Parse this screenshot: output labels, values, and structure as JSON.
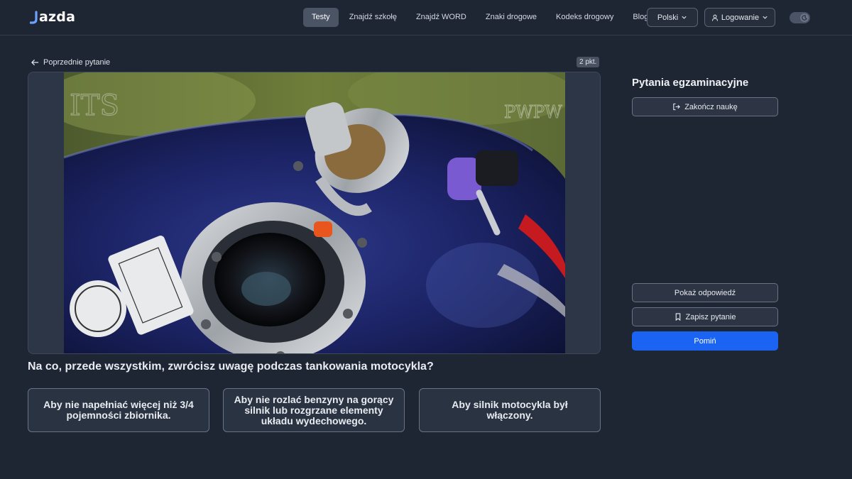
{
  "header": {
    "logo_text": "azda",
    "nav": [
      {
        "label": "Testy",
        "active": true
      },
      {
        "label": "Znajdź szkołę",
        "active": false
      },
      {
        "label": "Znajdź WORD",
        "active": false
      },
      {
        "label": "Znaki drogowe",
        "active": false
      },
      {
        "label": "Kodeks drogowy",
        "active": false
      },
      {
        "label": "Blog",
        "active": false
      }
    ],
    "language_label": "Polski",
    "login_label": "Logowanie",
    "theme_toggle_icon": "moon-icon"
  },
  "question": {
    "prev_label": "Poprzednie pytanie",
    "points": "2 pkt.",
    "image_watermark_left": "ITS",
    "image_watermark_right": "PWPW",
    "text": "Na co, przede wszystkim, zwrócisz uwagę podczas tankowania motocykla?",
    "answers": [
      "Aby nie napełniać więcej niż 3/4 pojemności zbiornika.",
      "Aby nie rozlać benzyny na gorący silnik lub rozgrzane elementy układu wydechowego.",
      "Aby silnik motocykla był włączony."
    ]
  },
  "sidebar": {
    "title": "Pytania egzaminacyjne",
    "finish_label": "Zakończ naukę",
    "show_answer_label": "Pokaż odpowiedź",
    "save_label": "Zapisz pytanie",
    "skip_label": "Pomiń"
  },
  "colors": {
    "background": "#1e2533",
    "accent": "#1b63f3",
    "logo_accent": "#6ea1ff"
  }
}
